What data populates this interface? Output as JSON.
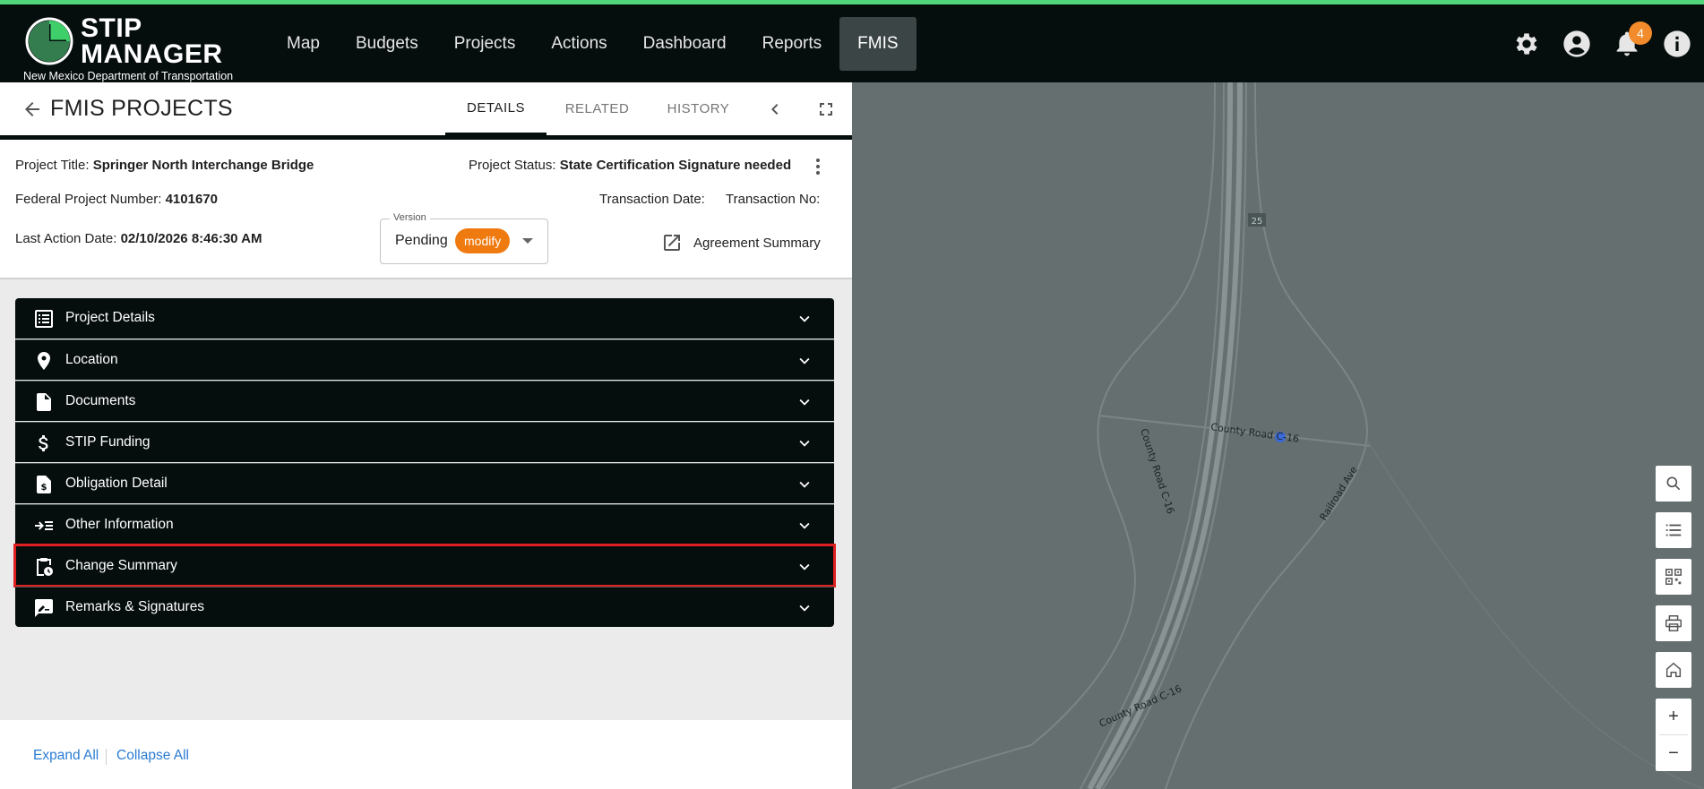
{
  "brand": {
    "line1": "STIP",
    "line2": "MANAGER",
    "department": "New Mexico Department of Transportation",
    "accent_color": "#4fd67a",
    "logo_green": "#3fcf6a"
  },
  "nav": {
    "items": [
      {
        "label": "Map"
      },
      {
        "label": "Budgets"
      },
      {
        "label": "Projects"
      },
      {
        "label": "Actions"
      },
      {
        "label": "Dashboard"
      },
      {
        "label": "Reports"
      },
      {
        "label": "FMIS",
        "active": true
      }
    ],
    "icons": [
      "gear-icon",
      "account-icon",
      "bell-icon",
      "info-icon"
    ],
    "notification_count": "4"
  },
  "panel": {
    "title": "FMIS PROJECTS",
    "tabs": [
      {
        "label": "DETAILS",
        "active": true
      },
      {
        "label": "RELATED"
      },
      {
        "label": "HISTORY"
      }
    ]
  },
  "project": {
    "title_label": "Project Title:",
    "title_value": "Springer North Interchange Bridge",
    "status_label": "Project Status:",
    "status_value": "State Certification Signature needed",
    "fed_number_label": "Federal Project Number:",
    "fed_number_value": "4101670",
    "transaction_date_label": "Transaction Date:",
    "transaction_no_label": "Transaction No:",
    "last_action_label": "Last Action Date:",
    "last_action_value": "02/10/2026 8:46:30 AM",
    "version_label": "Version",
    "version_value": "Pending",
    "version_chip": "modify",
    "agreement_label": "Agreement Summary"
  },
  "accordion": [
    {
      "label": "Project Details",
      "icon": "list-icon"
    },
    {
      "label": "Location",
      "icon": "location-pin-icon"
    },
    {
      "label": "Documents",
      "icon": "document-icon"
    },
    {
      "label": "STIP Funding",
      "icon": "dollar-icon"
    },
    {
      "label": "Obligation Detail",
      "icon": "invoice-icon"
    },
    {
      "label": "Other Information",
      "icon": "arrow-list-icon"
    },
    {
      "label": "Change Summary",
      "icon": "clipboard-clock-icon",
      "highlighted": true
    },
    {
      "label": "Remarks & Signatures",
      "icon": "signature-icon"
    }
  ],
  "footer": {
    "expand_all": "Expand All",
    "collapse_all": "Collapse All"
  },
  "map": {
    "labels": {
      "highway_shield": "25",
      "county_road_top": "County Road C-16",
      "county_road_left": "County Road C-16",
      "railroad": "Railroad Ave",
      "county_road_bottom": "County Road C-16"
    },
    "controls": [
      "search-icon",
      "list-icon",
      "qr-icon",
      "print-icon",
      "home-icon"
    ],
    "zoom_in": "+",
    "zoom_out": "−",
    "background_color": "#656f6f"
  }
}
